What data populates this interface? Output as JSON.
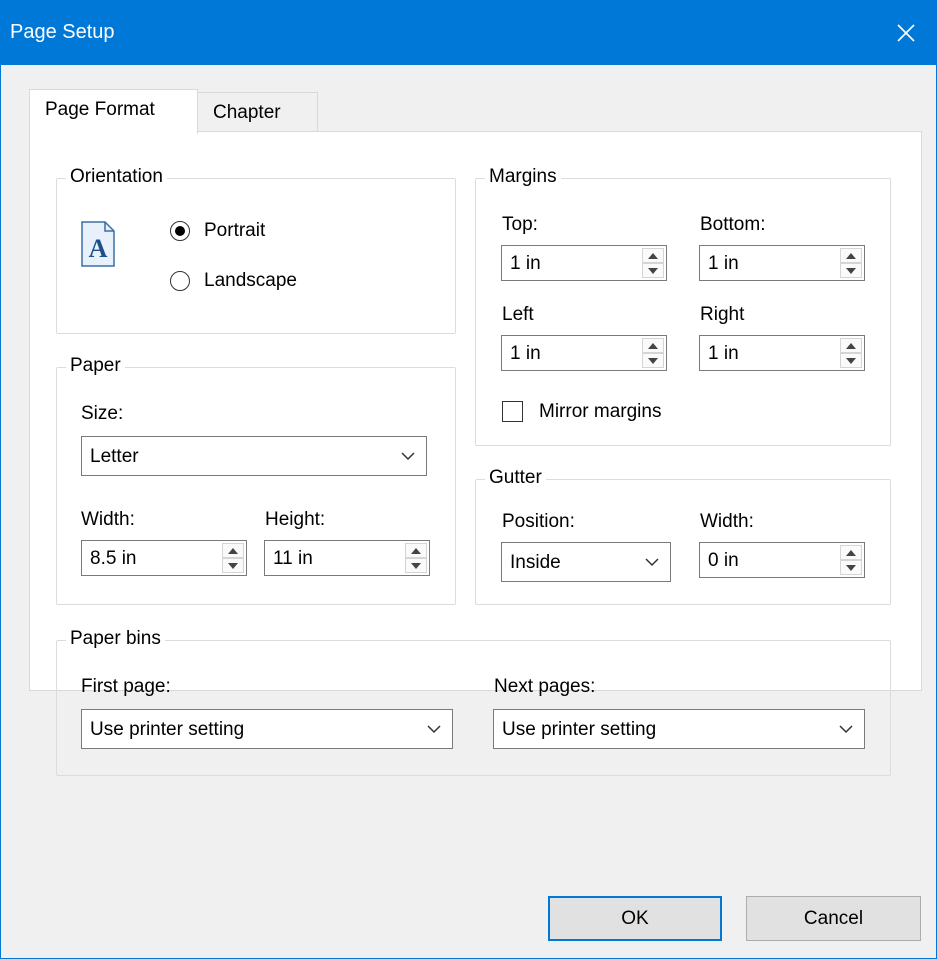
{
  "window": {
    "title": "Page Setup"
  },
  "tabs": [
    {
      "label": "Page Format",
      "active": true
    },
    {
      "label": "Chapter",
      "active": false
    }
  ],
  "orientation": {
    "legend": "Orientation",
    "icon_letter": "A",
    "portrait_label": "Portrait",
    "landscape_label": "Landscape",
    "selected": "Portrait"
  },
  "margins": {
    "legend": "Margins",
    "top_label": "Top:",
    "top_value": "1 in",
    "bottom_label": "Bottom:",
    "bottom_value": "1 in",
    "left_label": "Left",
    "left_value": "1 in",
    "right_label": "Right",
    "right_value": "1 in",
    "mirror_label": "Mirror margins",
    "mirror_checked": false
  },
  "paper": {
    "legend": "Paper",
    "size_label": "Size:",
    "size_value": "Letter",
    "width_label": "Width:",
    "width_value": "8.5 in",
    "height_label": "Height:",
    "height_value": "11 in"
  },
  "gutter": {
    "legend": "Gutter",
    "position_label": "Position:",
    "position_value": "Inside",
    "width_label": "Width:",
    "width_value": "0 in"
  },
  "paper_bins": {
    "legend": "Paper bins",
    "first_label": "First page:",
    "first_value": "Use printer setting",
    "next_label": "Next pages:",
    "next_value": "Use printer setting"
  },
  "buttons": {
    "ok": "OK",
    "cancel": "Cancel"
  },
  "colors": {
    "accent": "#0078d7",
    "dialog_bg": "#f0f0f0",
    "panel_bg": "#ffffff"
  }
}
